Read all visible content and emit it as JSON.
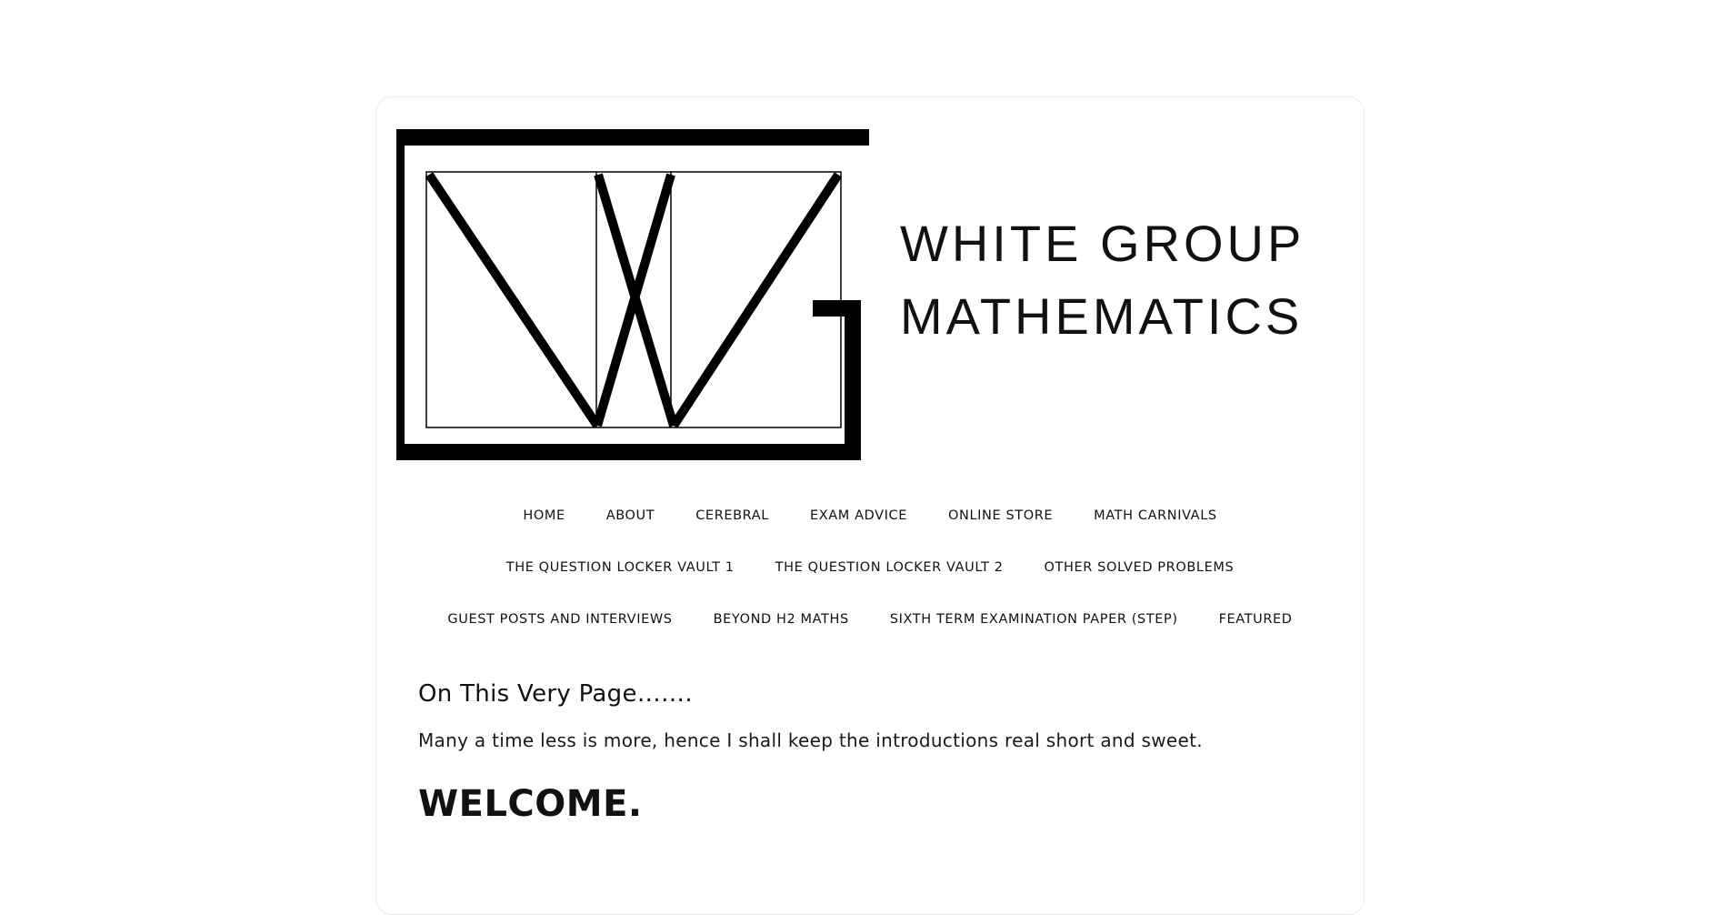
{
  "site": {
    "title_line1": "WHITE GROUP",
    "title_line2": "MATHEMATICS",
    "logo_icon": "wg-monogram-logo"
  },
  "nav": {
    "rows": [
      [
        "HOME",
        "ABOUT",
        "CEREBRAL",
        "EXAM ADVICE",
        "ONLINE STORE",
        "MATH CARNIVALS"
      ],
      [
        "THE QUESTION LOCKER VAULT 1",
        "THE QUESTION LOCKER VAULT 2",
        "OTHER SOLVED PROBLEMS"
      ],
      [
        "GUEST POSTS AND INTERVIEWS",
        "BEYOND H2 MATHS",
        "SIXTH TERM EXAMINATION PAPER (STEP)",
        "FEATURED"
      ]
    ]
  },
  "content": {
    "subheading": "On This Very Page…….",
    "intro": "Many a time less is more, hence I shall keep the introductions real short and sweet.",
    "welcome": "WELCOME."
  },
  "colors": {
    "text": "#111111",
    "card_border": "#ececec",
    "background": "#ffffff"
  }
}
